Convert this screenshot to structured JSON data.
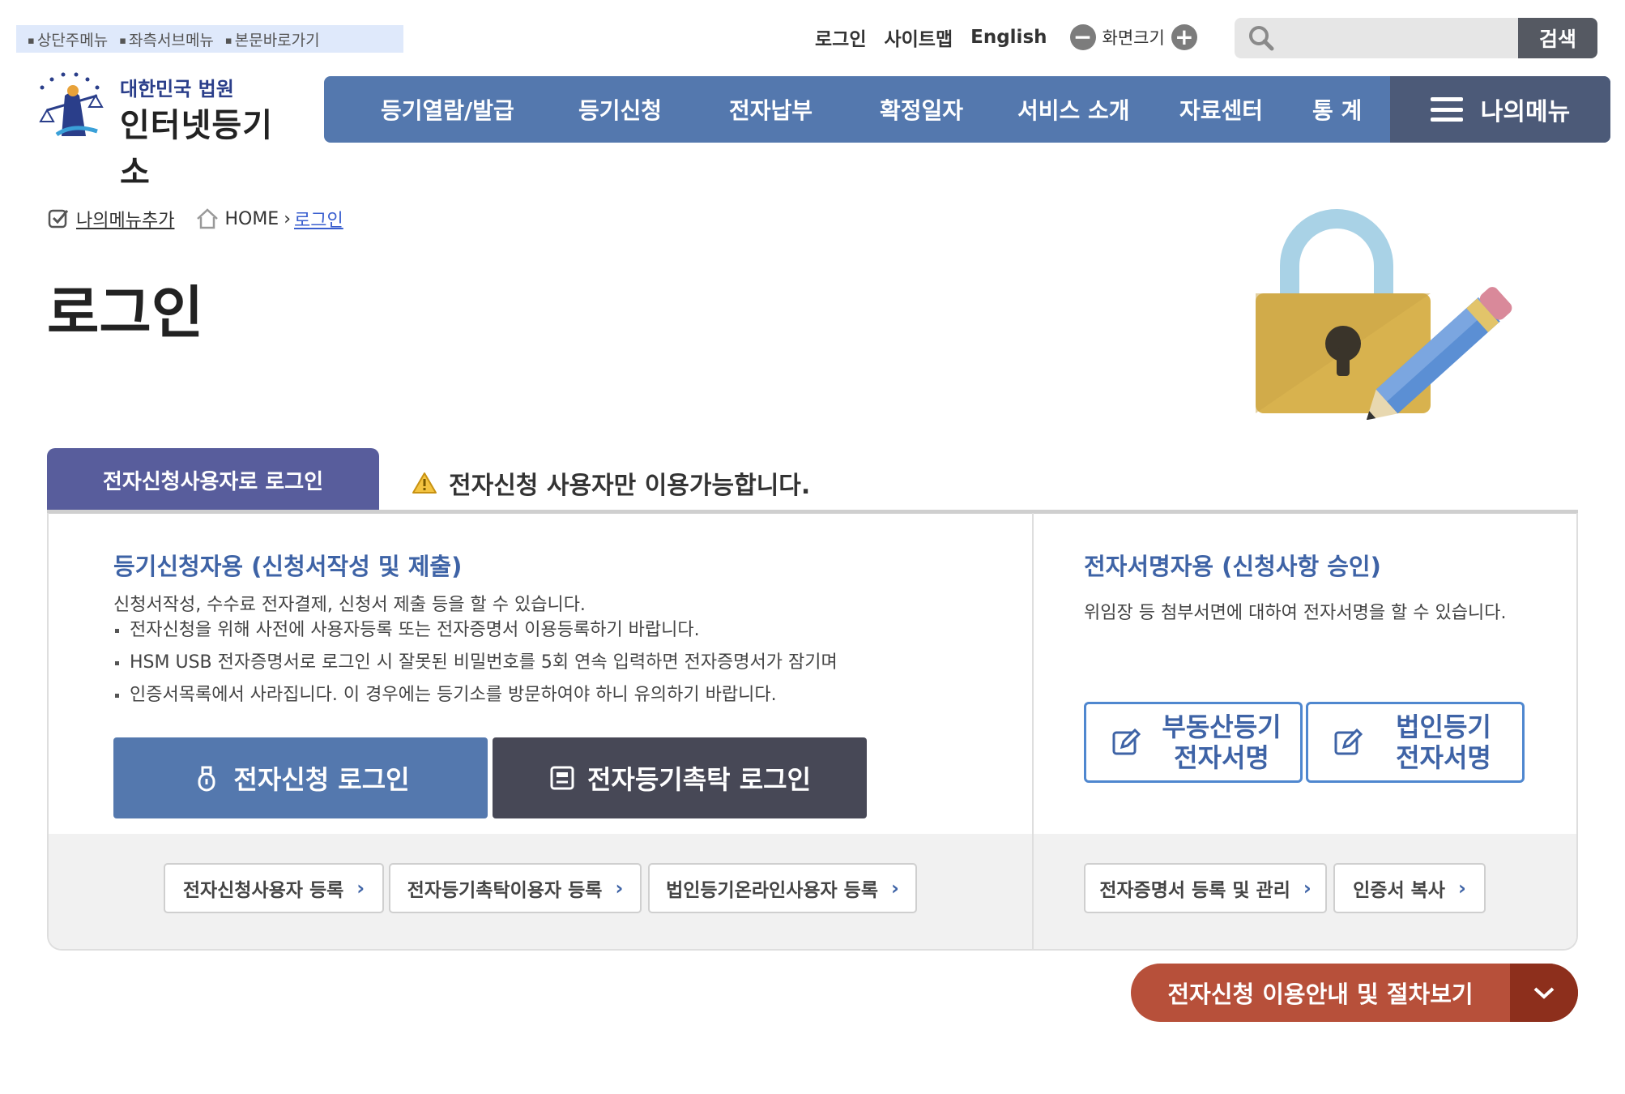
{
  "skip_links": [
    "상단주메뉴",
    "좌측서브메뉴",
    "본문바로가기"
  ],
  "util": {
    "login": "로그인",
    "sitemap": "사이트맵",
    "english": "English",
    "font_size": "화면크기"
  },
  "search": {
    "placeholder": "",
    "button": "검색"
  },
  "logo": {
    "line1": "대한민국 법원",
    "line2": "인터넷등기소"
  },
  "gnb": {
    "items": [
      "등기열람/발급",
      "등기신청",
      "전자납부",
      "확정일자",
      "서비스 소개",
      "자료센터",
      "통 계"
    ],
    "mymenu": "나의메뉴"
  },
  "breadcrumb": {
    "add_menu": "나의메뉴추가",
    "home": "HOME",
    "current": "로그인"
  },
  "page_title": "로그인",
  "tab": {
    "active": "전자신청사용자로 로그인",
    "notice": "전자신청 사용자만 이용가능합니다."
  },
  "left": {
    "heading": "등기신청자용 (신청서작성 및 제출)",
    "desc": "신청서작성, 수수료 전자결제, 신청서 제출 등을 할 수 있습니다.",
    "bullets": [
      "전자신청을 위해 사전에 사용자등록 또는 전자증명서 이용등록하기 바랍니다.",
      "HSM USB 전자증명서로 로그인 시 잘못된 비밀번호를 5회 연속 입력하면 전자증명서가 잠기며",
      "인증서목록에서 사라집니다. 이 경우에는 등기소를 방문하여야 하니 유의하기 바랍니다."
    ],
    "btn_login": "전자신청 로그인",
    "btn_trust": "전자등기촉탁 로그인",
    "reg_buttons": [
      "전자신청사용자 등록",
      "전자등기촉탁이용자 등록",
      "법인등기온라인사용자 등록"
    ]
  },
  "right": {
    "heading": "전자서명자용 (신청사항 승인)",
    "desc": "위임장 등 첨부서면에 대하여 전자서명을 할 수 있습니다.",
    "sign_realestate": [
      "부동산등기",
      "전자서명"
    ],
    "sign_corp": [
      "법인등기",
      "전자서명"
    ],
    "reg_buttons": [
      "전자증명서 등록 및 관리",
      "인증서 복사"
    ]
  },
  "guide_button": "전자신청 이용안내 및 절차보기",
  "colors": {
    "gnb": "#5478ae",
    "mymenu": "#4c5a78",
    "tab": "#585d9c",
    "heading": "#3e63a6",
    "guide": "#b7503a"
  }
}
